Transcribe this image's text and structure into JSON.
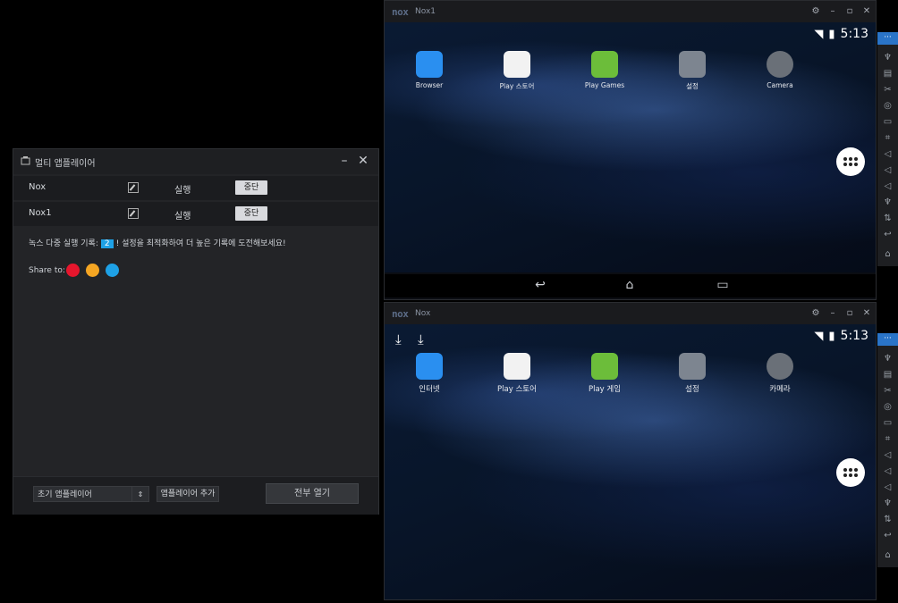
{
  "manager": {
    "title": "멀티 앱플레이어",
    "minimize": "–",
    "close": "✕",
    "rows": [
      {
        "name": "Nox",
        "status": "실행",
        "stop_label": "중단"
      },
      {
        "name": "Nox1",
        "status": "실행",
        "stop_label": "중단"
      }
    ],
    "record_prefix": "녹스 다중 실행 기록:",
    "record_count": "2",
    "record_suffix": "! 설정을 최적화하여 더 높은 기록에 도전해보세요!",
    "share_label": "Share to:",
    "share_icons": [
      "weibo-icon",
      "qzone-icon",
      "qq-icon"
    ],
    "select_value": "초기 앱플레이어",
    "add_button": "앱플레이어 추가",
    "open_all": "전부 열기"
  },
  "emulators": [
    {
      "instance": "Nox1",
      "time": "5:13",
      "apps": [
        "Browser",
        "Play 스토어",
        "Play Games",
        "설정",
        "Camera"
      ]
    },
    {
      "instance": "Nox",
      "time": "5:13",
      "apps": [
        "인터넷",
        "Play 스토어",
        "Play 게임",
        "설정",
        "카메라"
      ]
    }
  ],
  "logo_text": "nox",
  "colors": {
    "accent": "#1ea1e6",
    "weibo": "#e6162d",
    "qzone": "#f5a623",
    "qq": "#1ea1e6"
  }
}
